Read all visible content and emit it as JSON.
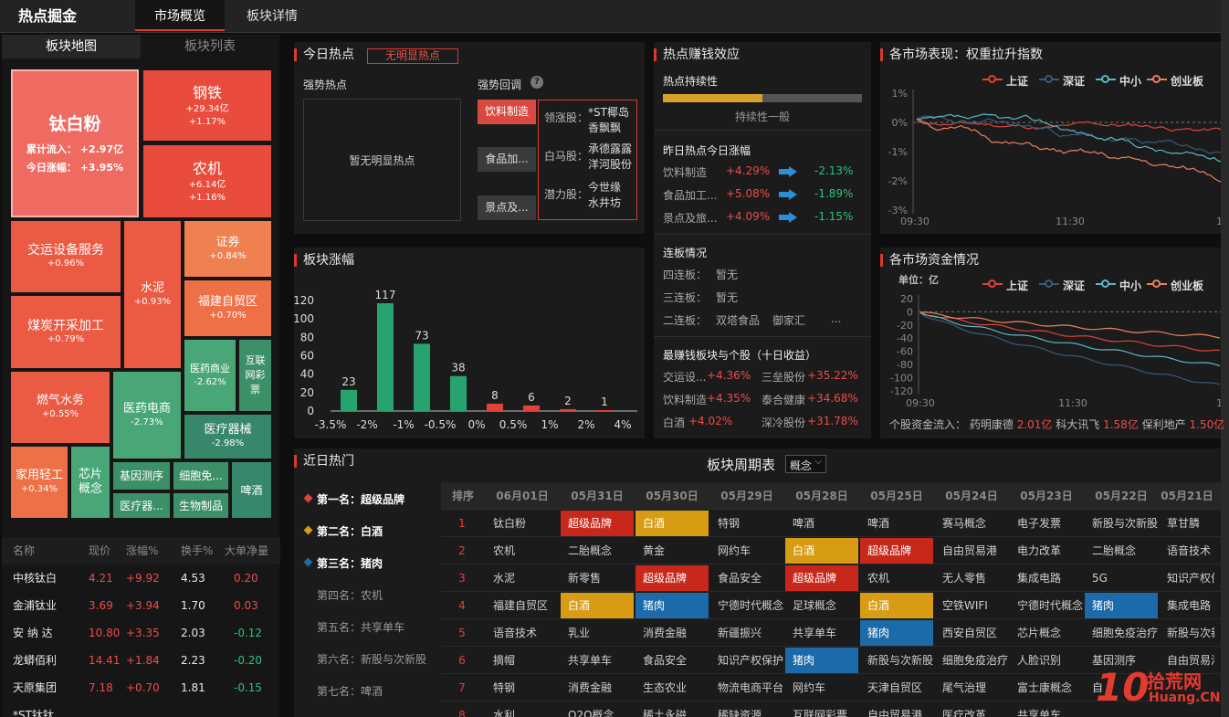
{
  "app": {
    "title": "热点掘金",
    "tabs": [
      "市场概览",
      "板块详情"
    ]
  },
  "left": {
    "subtabs": [
      "板块地图",
      "板块列表"
    ],
    "treemap": {
      "main": {
        "name": "钛白粉",
        "inflow_label": "累计流入：",
        "inflow": "+2.97亿",
        "gain_label": "今日涨幅：",
        "gain": "+3.95%"
      },
      "tiles": [
        {
          "name": "钢铁",
          "v1": "+29.34亿",
          "v2": "+1.17%"
        },
        {
          "name": "农机",
          "v1": "+6.14亿",
          "v2": "+1.16%"
        },
        {
          "name": "交运设备服务",
          "v1": "+0.96%"
        },
        {
          "name": "证券",
          "v1": "+0.84%"
        },
        {
          "name": "水泥",
          "v1": "+0.93%"
        },
        {
          "name": "福建自贸区",
          "v1": "+0.70%"
        },
        {
          "name": "煤炭开采加工",
          "v1": "+0.79%"
        },
        {
          "name": "医药商业",
          "v1": "-2.62%"
        },
        {
          "name": "互联网彩票"
        },
        {
          "name": "燃气水务",
          "v1": "+0.55%"
        },
        {
          "name": "医药电商",
          "v1": "-2.73%"
        },
        {
          "name": "医疗器械",
          "v1": "-2.98%"
        },
        {
          "name": "家用轻工",
          "v1": "+0.34%"
        },
        {
          "name": "芯片概念"
        },
        {
          "name": "基因测序"
        },
        {
          "name": "细胞免..."
        },
        {
          "name": "啤酒"
        },
        {
          "name": "医疗器..."
        },
        {
          "name": "生物制品"
        }
      ]
    },
    "table": {
      "headers": [
        "名称",
        "现价",
        "涨幅%",
        "换手%",
        "大单净量"
      ],
      "rows": [
        [
          "中核钛白",
          "4.21",
          "+9.92",
          "4.53",
          "0.20"
        ],
        [
          "金浦钛业",
          "3.69",
          "+3.94",
          "1.70",
          "0.03"
        ],
        [
          "安 纳 达",
          "10.80",
          "+3.35",
          "2.03",
          "-0.12"
        ],
        [
          "龙蟒佰利",
          "14.41",
          "+1.84",
          "2.23",
          "-0.20"
        ],
        [
          "天原集团",
          "7.18",
          "+0.70",
          "1.81",
          "-0.15"
        ],
        [
          "*ST钛钛",
          "",
          "",
          "",
          ""
        ]
      ]
    }
  },
  "today": {
    "title": "今日热点",
    "badge": "无明显热点",
    "strong_label": "强势热点",
    "strong_empty": "暂无明显热点",
    "pullback_label": "强势回调",
    "help": "?",
    "buttons": [
      "饮料制造",
      "食品加...",
      "景点及..."
    ],
    "details": [
      {
        "k": "领涨股：",
        "v": "*ST椰岛\n香飘飘"
      },
      {
        "k": "白马股：",
        "v": "承德露露\n洋河股份"
      },
      {
        "k": "潜力股：",
        "v": "今世缘\n水井坊"
      }
    ]
  },
  "effect": {
    "title": "热点赚钱效应",
    "persist_label": "热点持续性",
    "persist_value": 0.5,
    "persist_text": "持续性一般",
    "yesterday_label": "昨日热点今日涨幅",
    "yesterday": [
      {
        "name": "饮料制造",
        "prev": "+4.29%",
        "now": "-2.13%"
      },
      {
        "name": "食品加工...",
        "prev": "+5.08%",
        "now": "-1.89%"
      },
      {
        "name": "景点及旅...",
        "prev": "+4.09%",
        "now": "-1.15%"
      }
    ],
    "limit_label": "连板情况",
    "limit": [
      {
        "k": "四连板：",
        "v": "暂无",
        "v2": ""
      },
      {
        "k": "三连板：",
        "v": "暂无",
        "v2": ""
      },
      {
        "k": "二连板：",
        "v": "双塔食品",
        "v2": "御家汇",
        "v3": "..."
      }
    ],
    "best_label": "最赚钱板块与个股（十日收益）",
    "best": [
      {
        "a": "交运设...",
        "av": "+4.36%",
        "b": "三垒股份",
        "bv": "+35.22%"
      },
      {
        "a": "饮料制造",
        "av": "+4.35%",
        "b": "泰合健康",
        "bv": "+34.68%"
      },
      {
        "a": "白酒",
        "av": "+4.02%",
        "b": "深冷股份",
        "bv": "+31.78%"
      }
    ]
  },
  "markets": {
    "title": "各市场表现：权重拉升指数",
    "legend": [
      "上证",
      "深证",
      "中小",
      "创业板"
    ],
    "colors": [
      "#e0433a",
      "#3a5a78",
      "#5bb7c4",
      "#e8825e"
    ],
    "yticks": [
      "1%",
      "0%",
      "-1%",
      "-2%",
      "-3%"
    ],
    "xticks": [
      "09:30",
      "11:30",
      "15"
    ]
  },
  "funds": {
    "title": "各市场资金情况",
    "unit": "单位：亿",
    "legend": [
      "上证",
      "深证",
      "中小",
      "创业板"
    ],
    "yticks": [
      "20",
      "0",
      "-20",
      "-40",
      "-60",
      "-80",
      "-100",
      "-120"
    ],
    "xticks": [
      "09:30",
      "11:30",
      "15"
    ],
    "inflow_label": "个股资金流入：",
    "inflow": [
      {
        "n": "药明康德",
        "v": "2.01亿"
      },
      {
        "n": "科大讯飞",
        "v": "1.58亿"
      },
      {
        "n": "保利地产",
        "v": "1.50亿"
      }
    ]
  },
  "bars": {
    "title": "板块涨幅",
    "chart_data": {
      "type": "bar",
      "categories": [
        "-3.5%",
        "-2%",
        "-1%",
        "-0.5%",
        "0%",
        "0.5%",
        "1%",
        "2%",
        "4%"
      ],
      "values": [
        23,
        117,
        73,
        38,
        8,
        6,
        2,
        1
      ],
      "yticks": [
        0,
        20,
        40,
        60,
        80,
        100,
        120
      ],
      "ylim": [
        0,
        120
      ]
    }
  },
  "recent": {
    "title": "近日热门",
    "items": [
      {
        "rank": "第一名：",
        "name": "超级品牌",
        "mark": "#e0433a"
      },
      {
        "rank": "第二名：",
        "name": "白酒",
        "mark": "#d89b14"
      },
      {
        "rank": "第三名：",
        "name": "猪肉",
        "mark": "#1d6aaa"
      },
      {
        "rank": "第四名：",
        "name": "农机"
      },
      {
        "rank": "第五名：",
        "name": "共享单车"
      },
      {
        "rank": "第六名：",
        "name": "新股与次新股"
      },
      {
        "rank": "第七名：",
        "name": "啤酒"
      }
    ]
  },
  "cycle": {
    "title": "板块周期表",
    "select": "概念",
    "headers": [
      "排序",
      "06月01日",
      "05月31日",
      "05月30日",
      "05月29日",
      "05月28日",
      "05月25日",
      "05月24日",
      "05月23日",
      "05月22日",
      "05月21日"
    ],
    "rows": [
      [
        "1",
        "钛白粉",
        "超级品牌",
        "白酒",
        "特钢",
        "啤酒",
        "啤酒",
        "赛马概念",
        "电子发票",
        "新股与次新股",
        "草甘膦"
      ],
      [
        "2",
        "农机",
        "二胎概念",
        "黄金",
        "网约车",
        "白酒",
        "超级品牌",
        "自由贸易港",
        "电力改革",
        "二胎概念",
        "语音技术"
      ],
      [
        "3",
        "水泥",
        "新零售",
        "超级品牌",
        "食品安全",
        "超级品牌",
        "农机",
        "无人零售",
        "集成电路",
        "5G",
        "知识产权保"
      ],
      [
        "4",
        "福建自贸区",
        "白酒",
        "猪肉",
        "宁德时代概念",
        "足球概念",
        "白酒",
        "空铁WIFI",
        "宁德时代概念",
        "猪肉",
        "集成电路"
      ],
      [
        "5",
        "语音技术",
        "乳业",
        "消费金融",
        "新疆振兴",
        "共享单车",
        "猪肉",
        "西安自贸区",
        "芯片概念",
        "细胞免疫治疗",
        "新股与次新"
      ],
      [
        "6",
        "摘帽",
        "共享单车",
        "食品安全",
        "知识产权保护",
        "猪肉",
        "新股与次新股",
        "细胞免疫治疗",
        "人脸识别",
        "基因测序",
        "自由贸易港"
      ],
      [
        "7",
        "特钢",
        "消费金融",
        "生态农业",
        "物流电商平台",
        "网约车",
        "天津自贸区",
        "尾气治理",
        "富士康概念",
        "自",
        ""
      ],
      [
        "8",
        "水利",
        "O2O概念",
        "稀土永磁",
        "稀缺资源",
        "互联网彩票",
        "自由贸易港",
        "医疗改革",
        "共享单车",
        "",
        ""
      ]
    ]
  },
  "watermark": {
    "num": "10",
    "cn": "拾荒网",
    "en": "Huang.CN"
  }
}
